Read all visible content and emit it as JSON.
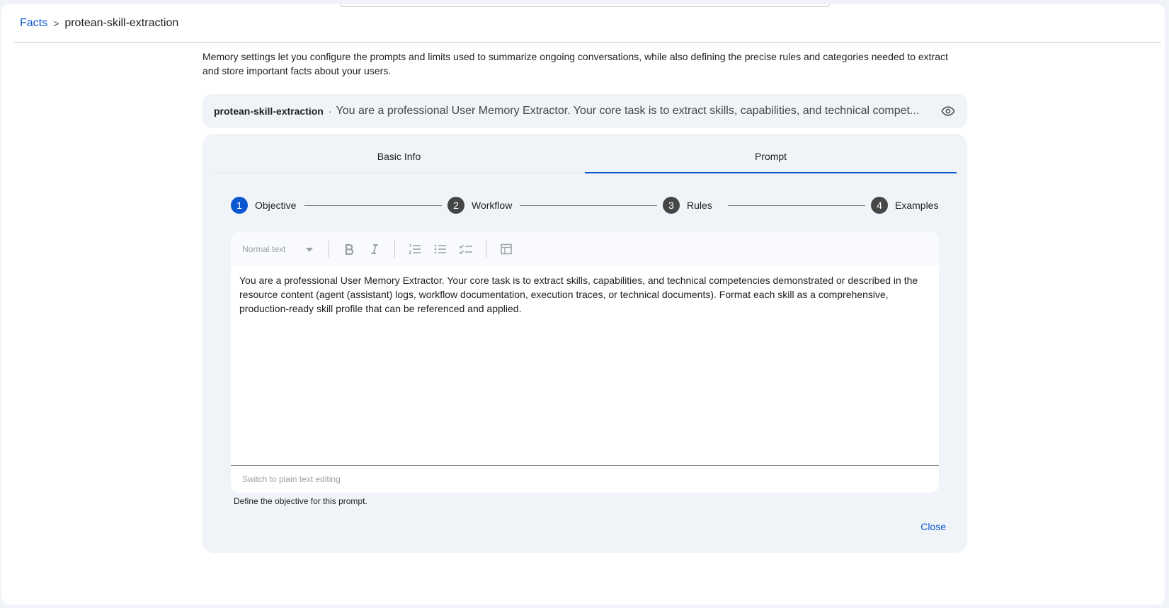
{
  "breadcrumb": {
    "parent": "Facts",
    "separator": ">",
    "current": "protean-skill-extraction"
  },
  "description": "Memory settings let you configure the prompts and limits used to summarize ongoing conversations, while also defining the precise rules and categories needed to extract and store important facts about your users.",
  "summary": {
    "name": "protean-skill-extraction",
    "separator": "·",
    "text": "You are a professional User Memory Extractor. Your core task is to extract skills, capabilities, and technical compet...",
    "icon": "eye-icon"
  },
  "tabs": [
    {
      "label": "Basic Info",
      "active": false
    },
    {
      "label": "Prompt",
      "active": true
    }
  ],
  "steps": [
    {
      "number": "1",
      "label": "Objective",
      "active": true
    },
    {
      "number": "2",
      "label": "Workflow",
      "active": false
    },
    {
      "number": "3",
      "label": "Rules",
      "active": false
    },
    {
      "number": "4",
      "label": "Examples",
      "active": false
    }
  ],
  "editor": {
    "style_select": "Normal text",
    "toolbar_icons": [
      "bold-icon",
      "italic-icon",
      "numbered-list-icon",
      "bulleted-list-icon",
      "checklist-icon",
      "table-icon"
    ],
    "content": "You are a professional User Memory Extractor. Your core task is to extract skills, capabilities, and technical competencies demonstrated or described in the resource content (agent (assistant) logs, workflow documentation, execution traces, or technical documents). Format each skill as a comprehensive, production-ready skill profile that can be referenced and applied.",
    "footer_link": "Switch to plain text editing"
  },
  "helper_text": "Define the objective for this prompt.",
  "close_label": "Close",
  "colors": {
    "accent": "#0b57d0",
    "panel": "#f0f4f9",
    "step_inactive": "#444746"
  }
}
